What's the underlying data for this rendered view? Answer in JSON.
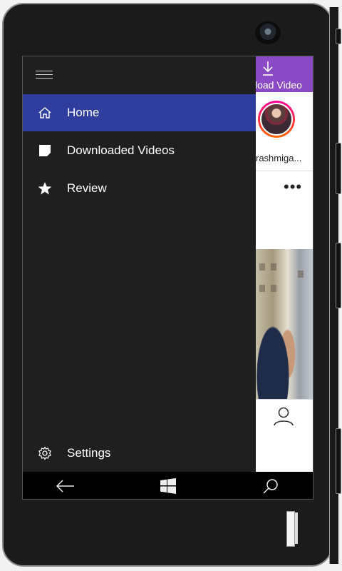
{
  "app": {
    "header_label": "load Video",
    "username": "rashmiga...",
    "options_label": "•••"
  },
  "drawer": {
    "items": [
      {
        "label": "Home",
        "icon": "home-icon",
        "selected": true
      },
      {
        "label": "Downloaded Videos",
        "icon": "document-icon",
        "selected": false
      },
      {
        "label": "Review",
        "icon": "star-icon",
        "selected": false
      }
    ],
    "settings_label": "Settings"
  },
  "navbar": {
    "icons": [
      "back-arrow-icon",
      "windows-start-icon",
      "search-icon"
    ]
  },
  "colors": {
    "accent": "#2f3e9e",
    "header": "#8a49c5",
    "drawer_bg": "#1f1f1f"
  }
}
